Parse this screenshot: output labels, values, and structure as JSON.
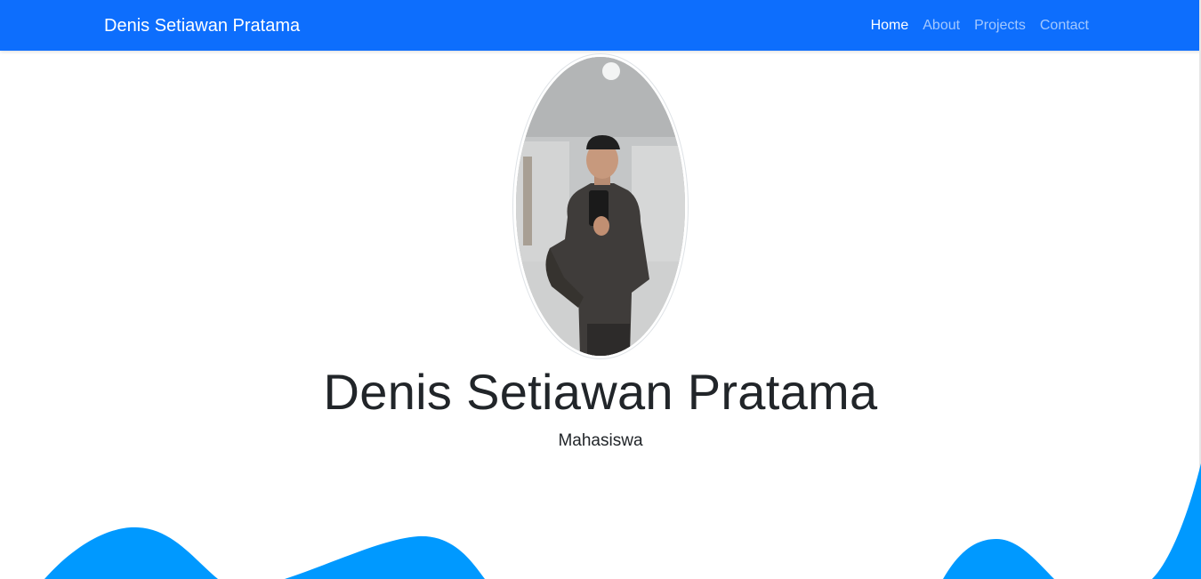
{
  "navbar": {
    "brand": "Denis Setiawan Pratama",
    "links": [
      {
        "label": "Home",
        "active": true
      },
      {
        "label": "About",
        "active": false
      },
      {
        "label": "Projects",
        "active": false
      },
      {
        "label": "Contact",
        "active": false
      }
    ]
  },
  "hero": {
    "name": "Denis Setiawan Pratama",
    "subtitle": "Mahasiswa"
  },
  "colors": {
    "navbar_bg": "#0d6efd",
    "wave": "#0099ff",
    "text": "#212529"
  }
}
